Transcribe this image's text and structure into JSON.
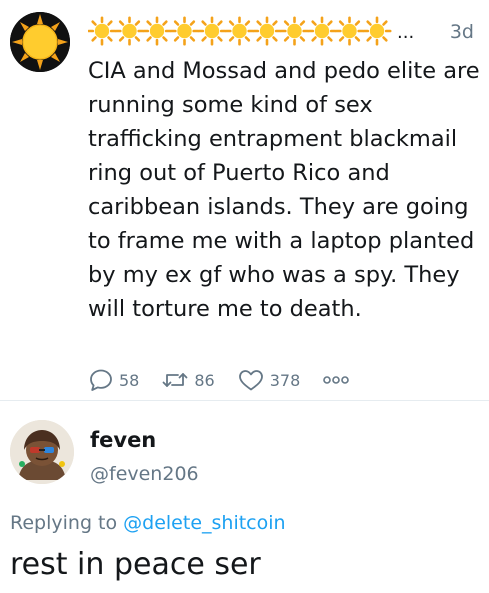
{
  "tweet": {
    "display_name_icon": "sun-emoji",
    "display_name_ellipsis": "...",
    "time": "3d",
    "text": "CIA and Mossad and pedo elite are running some kind of sex trafficking entrapment blackmail ring out of Puerto Rico and caribbean islands. They are going to frame me with a laptop planted by my ex gf who was a spy. They will torture me to death.",
    "actions": {
      "replies": "58",
      "retweets": "86",
      "likes": "378"
    }
  },
  "reply": {
    "name": "feven",
    "handle": "@feven206",
    "replying_prefix": "Replying to ",
    "replying_to": "@delete_shitcoin",
    "text": "rest in peace ser"
  },
  "colors": {
    "text": "#14171a",
    "secondary": "#657786",
    "link": "#1da1f2",
    "sun": "#ffcc2e",
    "sun_ray": "#f4a21a",
    "divider": "#e6ecf0"
  }
}
